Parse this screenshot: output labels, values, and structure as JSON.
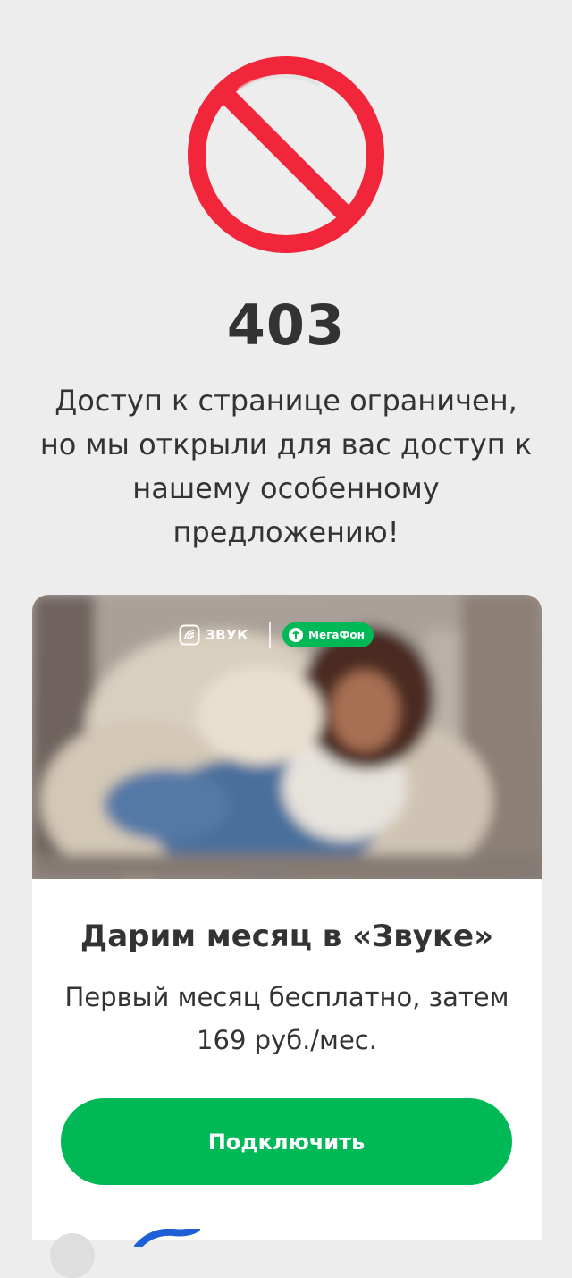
{
  "error": {
    "code": "403",
    "message": "Доступ к странице ограничен, но мы открыли для вас доступ к нашему особенному предложению!"
  },
  "icons": {
    "forbidden": "forbidden-sign-icon",
    "zvuk": "zvuk-icon",
    "megafon": "megafon-icon"
  },
  "banner": {
    "zvuk_brand": "ЗВУК",
    "megafon_brand": "МегаФон"
  },
  "offer": {
    "title": "Дарим месяц в «Звуке»",
    "subtitle": "Первый месяц бесплатно, затем 169 руб./мес.",
    "button_label": "Подключить"
  },
  "colors": {
    "background": "#ededed",
    "forbidden_red": "#f2263a",
    "megafon_green": "#00b956",
    "text": "#333333"
  }
}
